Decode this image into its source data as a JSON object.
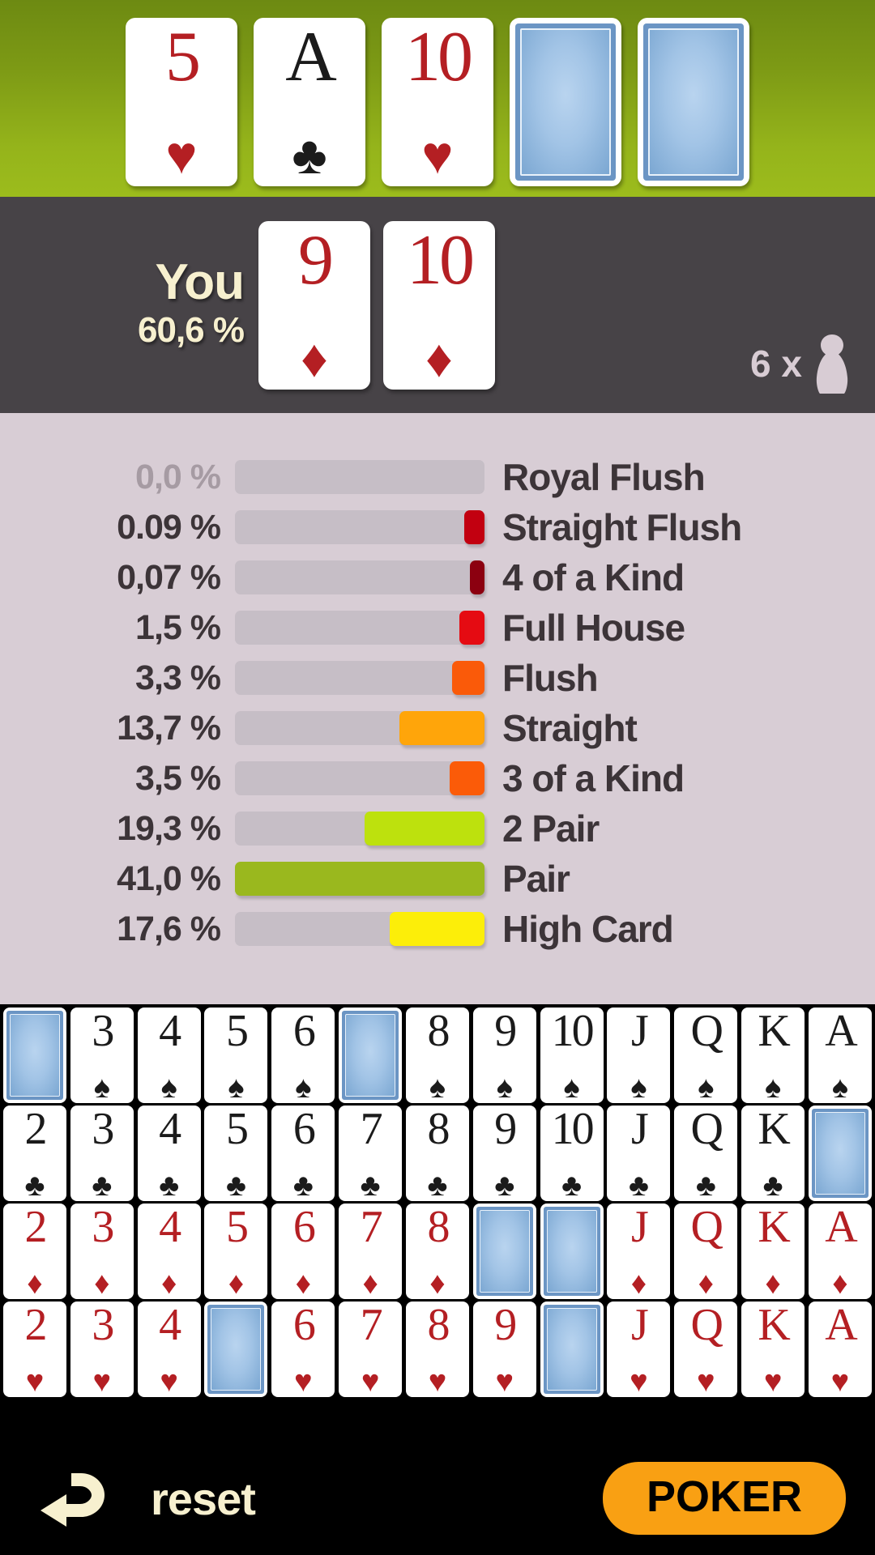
{
  "board": {
    "name": "community-cards",
    "cards": [
      {
        "rank": "5",
        "suit": "hearts",
        "pip": "♥",
        "color": "red",
        "facedown": false
      },
      {
        "rank": "A",
        "suit": "clubs",
        "pip": "♣",
        "color": "black",
        "facedown": false
      },
      {
        "rank": "10",
        "suit": "hearts",
        "pip": "♥",
        "color": "red",
        "facedown": false
      },
      {
        "rank": "",
        "suit": "",
        "pip": "",
        "color": "",
        "facedown": true
      },
      {
        "rank": "",
        "suit": "",
        "pip": "",
        "color": "",
        "facedown": true
      }
    ]
  },
  "player": {
    "label": "You",
    "win_percent": "60,6 %",
    "hole_cards": [
      {
        "rank": "9",
        "suit": "diamonds",
        "pip": "♦",
        "color": "red",
        "facedown": false
      },
      {
        "rank": "10",
        "suit": "diamonds",
        "pip": "♦",
        "color": "red",
        "facedown": false
      }
    ],
    "opponents_count": "6 x",
    "opponents_icon": "pawn-icon"
  },
  "odds": {
    "rows": [
      {
        "percent": "0,0 %",
        "label": "Royal Flush",
        "value": 0.0,
        "bar_percent": 0,
        "color": "#c6bec6",
        "dimmed": true
      },
      {
        "percent": "0.09 %",
        "label": "Straight Flush",
        "value": 0.09,
        "bar_percent": 8,
        "color": "#c20010",
        "dimmed": false
      },
      {
        "percent": "0,07 %",
        "label": "4 of a Kind",
        "value": 0.07,
        "bar_percent": 6,
        "color": "#8c0010",
        "dimmed": false
      },
      {
        "percent": "1,5 %",
        "label": "Full House",
        "value": 1.5,
        "bar_percent": 10,
        "color": "#e50b12",
        "dimmed": false
      },
      {
        "percent": "3,3 %",
        "label": "Flush",
        "value": 3.3,
        "bar_percent": 13,
        "color": "#fa5a09",
        "dimmed": false
      },
      {
        "percent": "13,7 %",
        "label": "Straight",
        "value": 13.7,
        "bar_percent": 34,
        "color": "#ffa50a",
        "dimmed": false
      },
      {
        "percent": "3,5 %",
        "label": "3 of a Kind",
        "value": 3.5,
        "bar_percent": 14,
        "color": "#fb5b08",
        "dimmed": false
      },
      {
        "percent": "19,3 %",
        "label": "2 Pair",
        "value": 19.3,
        "bar_percent": 48,
        "color": "#bde10d",
        "dimmed": false
      },
      {
        "percent": "41,0 %",
        "label": "Pair",
        "value": 41.0,
        "bar_percent": 100,
        "color": "#9ab81e",
        "dimmed": false
      },
      {
        "percent": "17,6 %",
        "label": "High Card",
        "value": 17.6,
        "bar_percent": 38,
        "color": "#fcee09",
        "dimmed": false
      }
    ]
  },
  "chart_data": {
    "type": "bar",
    "title": "Poker hand probabilities",
    "orientation": "horizontal",
    "categories": [
      "Royal Flush",
      "Straight Flush",
      "4 of a Kind",
      "Full House",
      "Flush",
      "Straight",
      "3 of a Kind",
      "2 Pair",
      "Pair",
      "High Card"
    ],
    "values": [
      0.0,
      0.09,
      0.07,
      1.5,
      3.3,
      13.7,
      3.5,
      19.3,
      41.0,
      17.6
    ],
    "value_labels": [
      "0,0 %",
      "0.09 %",
      "0,07 %",
      "1,5 %",
      "3,3 %",
      "13,7 %",
      "3,5 %",
      "19,3 %",
      "41,0 %",
      "17,6 %"
    ],
    "bar_colors": [
      "#c6bec6",
      "#c20010",
      "#8c0010",
      "#e50b12",
      "#fa5a09",
      "#ffa50a",
      "#fb5b08",
      "#bde10d",
      "#9ab81e",
      "#fcee09"
    ],
    "xlabel": "",
    "ylabel": "",
    "xlim": [
      0,
      41.0
    ],
    "grid": false,
    "legend": false,
    "notes": "Bars grow right-to-left from the right edge of a fixed-width track; scale normalized so Pair (41,0 %) fills the full track."
  },
  "deck": {
    "rows": [
      {
        "suit": "spades",
        "pip": "♠",
        "color": "black",
        "cards": [
          {
            "rank": "2",
            "facedown": true
          },
          {
            "rank": "3",
            "facedown": false
          },
          {
            "rank": "4",
            "facedown": false
          },
          {
            "rank": "5",
            "facedown": false
          },
          {
            "rank": "6",
            "facedown": false
          },
          {
            "rank": "7",
            "facedown": true
          },
          {
            "rank": "8",
            "facedown": false
          },
          {
            "rank": "9",
            "facedown": false
          },
          {
            "rank": "10",
            "facedown": false
          },
          {
            "rank": "J",
            "facedown": false
          },
          {
            "rank": "Q",
            "facedown": false
          },
          {
            "rank": "K",
            "facedown": false
          },
          {
            "rank": "A",
            "facedown": false
          }
        ]
      },
      {
        "suit": "clubs",
        "pip": "♣",
        "color": "black",
        "cards": [
          {
            "rank": "2",
            "facedown": false
          },
          {
            "rank": "3",
            "facedown": false
          },
          {
            "rank": "4",
            "facedown": false
          },
          {
            "rank": "5",
            "facedown": false
          },
          {
            "rank": "6",
            "facedown": false
          },
          {
            "rank": "7",
            "facedown": false
          },
          {
            "rank": "8",
            "facedown": false
          },
          {
            "rank": "9",
            "facedown": false
          },
          {
            "rank": "10",
            "facedown": false
          },
          {
            "rank": "J",
            "facedown": false
          },
          {
            "rank": "Q",
            "facedown": false
          },
          {
            "rank": "K",
            "facedown": false
          },
          {
            "rank": "A",
            "facedown": true
          }
        ]
      },
      {
        "suit": "diamonds",
        "pip": "♦",
        "color": "red",
        "cards": [
          {
            "rank": "2",
            "facedown": false
          },
          {
            "rank": "3",
            "facedown": false
          },
          {
            "rank": "4",
            "facedown": false
          },
          {
            "rank": "5",
            "facedown": false
          },
          {
            "rank": "6",
            "facedown": false
          },
          {
            "rank": "7",
            "facedown": false
          },
          {
            "rank": "8",
            "facedown": false
          },
          {
            "rank": "9",
            "facedown": true
          },
          {
            "rank": "10",
            "facedown": true
          },
          {
            "rank": "J",
            "facedown": false
          },
          {
            "rank": "Q",
            "facedown": false
          },
          {
            "rank": "K",
            "facedown": false
          },
          {
            "rank": "A",
            "facedown": false
          }
        ]
      },
      {
        "suit": "hearts",
        "pip": "♥",
        "color": "red",
        "cards": [
          {
            "rank": "2",
            "facedown": false
          },
          {
            "rank": "3",
            "facedown": false
          },
          {
            "rank": "4",
            "facedown": false
          },
          {
            "rank": "5",
            "facedown": true
          },
          {
            "rank": "6",
            "facedown": false
          },
          {
            "rank": "7",
            "facedown": false
          },
          {
            "rank": "8",
            "facedown": false
          },
          {
            "rank": "9",
            "facedown": false
          },
          {
            "rank": "10",
            "facedown": true
          },
          {
            "rank": "J",
            "facedown": false
          },
          {
            "rank": "Q",
            "facedown": false
          },
          {
            "rank": "K",
            "facedown": false
          },
          {
            "rank": "A",
            "facedown": false
          }
        ]
      }
    ]
  },
  "bottom_bar": {
    "back_icon": "back-arrow-icon",
    "reset_label": "reset",
    "poker_label": "POKER",
    "poker_color": "#f9a013"
  }
}
